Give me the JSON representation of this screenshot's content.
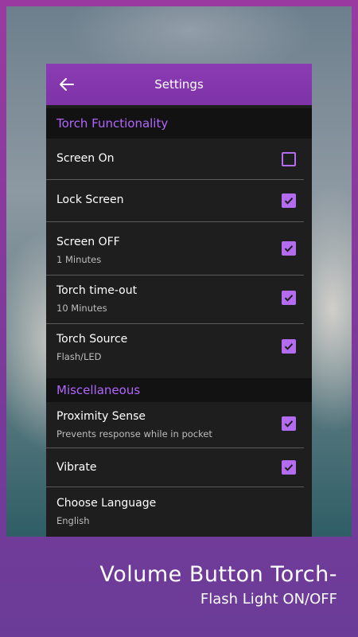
{
  "toolbar": {
    "title": "Settings",
    "back_icon": "arrow-left-icon"
  },
  "sections": [
    {
      "header": "Torch Functionality"
    },
    {
      "header": "Miscellaneous"
    }
  ],
  "items": [
    {
      "title": "Screen On",
      "subtitle": "",
      "checked": false
    },
    {
      "title": "Lock Screen",
      "subtitle": "",
      "checked": true
    },
    {
      "title": "Screen OFF",
      "subtitle": "1 Minutes",
      "checked": true
    },
    {
      "title": "Torch time-out",
      "subtitle": "10 Minutes",
      "checked": true
    },
    {
      "title": "Torch Source",
      "subtitle": "Flash/LED",
      "checked": true
    },
    {
      "title": "Proximity Sense",
      "subtitle": "Prevents response while in pocket",
      "checked": true
    },
    {
      "title": "Vibrate",
      "subtitle": "",
      "checked": true
    },
    {
      "title": "Choose Language",
      "subtitle": "English"
    }
  ],
  "promo": {
    "line1": "Volume Button Torch-",
    "line2": "Flash Light ON/OFF"
  },
  "colors": {
    "accent": "#b36bf0",
    "toolbar": "#8b3bb2",
    "card": "#1e1e1e"
  }
}
